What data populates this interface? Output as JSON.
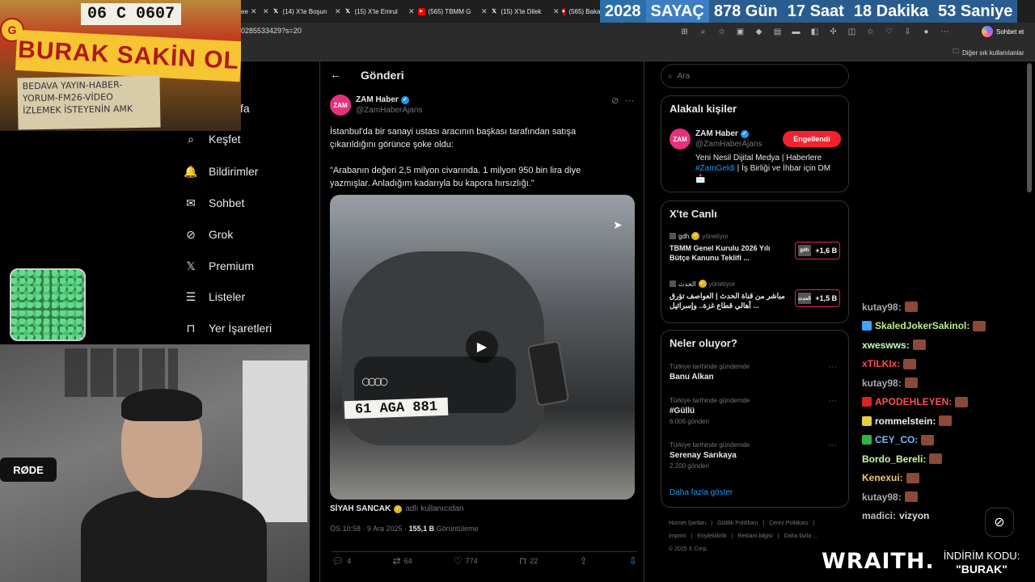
{
  "browser": {
    "tabs": [
      {
        "icon": "x",
        "label": "(14) X'te Boşun"
      },
      {
        "icon": "x",
        "label": "(15) X'te Emrul"
      },
      {
        "icon": "yt",
        "label": "(565) TBMM G"
      },
      {
        "icon": "x",
        "label": "(15) X'te Dilek"
      },
      {
        "icon": "yt",
        "label": "(565) Baka"
      }
    ],
    "partial_tab": "ee",
    "url": "0285533429?s=20",
    "copilot_label": "Sohbet et",
    "bookmarks_label": "Diğer sık kullanılanlar"
  },
  "countdown": {
    "year": "2028",
    "label": "SAYAÇ",
    "days": "878 Gün",
    "hours": "17 Saat",
    "minutes": "18 Dakika",
    "seconds": "53 Saniye"
  },
  "overlay": {
    "plate": "06 C 0607",
    "banner": "BURAK SAKİN OL",
    "cardboard": "BEDAVA YAYIN-HABER-\nYORUM-FM26-VİDEO\nİZLEMEK İSTEYENİN AMK",
    "mic_brand": "RØDE"
  },
  "nav": {
    "partial_home": "yfa",
    "items": [
      {
        "icon": "search-icon",
        "glyph": "⌕",
        "label": "Keşfet"
      },
      {
        "icon": "bell-icon",
        "glyph": "🔔",
        "label": "Bildirimler"
      },
      {
        "icon": "mail-icon",
        "glyph": "✉",
        "label": "Sohbet"
      },
      {
        "icon": "grok-icon",
        "glyph": "⊘",
        "label": "Grok"
      },
      {
        "icon": "x-logo-icon",
        "glyph": "𝕏",
        "label": "Premium"
      },
      {
        "icon": "list-icon",
        "glyph": "☰",
        "label": "Listeler"
      },
      {
        "icon": "bookmark-icon",
        "glyph": "⊓",
        "label": "Yer İşaretleri"
      }
    ]
  },
  "post": {
    "header": "Gönderi",
    "author_name": "ZAM Haber",
    "author_handle": "@ZamHaberAjans",
    "avatar_text": "ZAM",
    "text": "İstanbul'da bir sanayi ustası aracının başkası tarafından satışa\nçıkarıldığını görünce şoke oldu:\n\n\"Arabanın değeri 2,5 milyon civarında. 1 milyon 950 bin lira diye\nyazmışlar. Anladığım kadarıyla bu kapora hırsızlığı.\"",
    "video_plate": "61 AGA 881",
    "credit_name": "SİYAH SANCAK",
    "credit_sub": "adlı kullanıcıdan",
    "time": "ÖS 10:58 · 9 Ara 2025 · ",
    "views_count": "155,1 B",
    "views_label": " Görüntüleme",
    "actions": {
      "replies": "4",
      "reposts": "64",
      "likes": "774",
      "bookmarks": "22"
    }
  },
  "right": {
    "search_placeholder": "Ara",
    "related": {
      "title": "Alakalı kişiler",
      "name": "ZAM Haber",
      "handle": "@ZamHaberAjans",
      "button": "Engellendi",
      "bio_pre": "Yeni Nesil Dijital Medya | Haberlere",
      "bio_tag": "#ZamGeldi",
      "bio_post": " | İş Birliği ve İhbar için DM",
      "bio_emoji": "📩"
    },
    "live": {
      "title": "X'te Canlı",
      "items": [
        {
          "host": "gdh",
          "role": "yönetiyor",
          "title": "TBMM Genel Kurulu 2026 Yılı Bütçe Kanunu Teklifi ...",
          "mini": "gdh",
          "count": "+1,6 B"
        },
        {
          "host": "الحدث",
          "role": "yönetiyor",
          "title": "مباشر من قناة الحدث | العواصف تؤرق أهالي قطاع غزة.. وإسرائيل ...",
          "mini": "الحدث",
          "count": "+1,5 B"
        }
      ]
    },
    "trends": {
      "title": "Neler oluyor?",
      "items": [
        {
          "context": "Türkiye tarihinde gündemde",
          "name": "Banu Alkan",
          "count": ""
        },
        {
          "context": "Türkiye tarihinde gündemde",
          "name": "#Güllü",
          "count": "6.006 gönderi"
        },
        {
          "context": "Türkiye tarihinde gündemde",
          "name": "Serenay Sarıkaya",
          "count": "2.200 gönderi"
        }
      ],
      "show_more": "Daha fazla göster"
    },
    "footer": [
      "Hizmet Şartları",
      "|",
      "Gizlilik Politikası",
      "|",
      "Çerez Politikası",
      "|",
      "Imprint",
      "|",
      "Erişilebilirlik",
      "|",
      "Reklam bilgisi",
      "|",
      "Daha fazla ...",
      "© 2025 X Corp."
    ]
  },
  "chat": [
    {
      "user": "kutay98:",
      "color": "#a9a9a9",
      "badge": "",
      "msg": ""
    },
    {
      "user": "SkaledJokerSakinol:",
      "color": "#b8f08a",
      "badge": "#3aa6ff",
      "msg": ""
    },
    {
      "user": "xweswws:",
      "color": "#c0ffc0",
      "badge": "",
      "msg": ""
    },
    {
      "user": "xTILKIx:",
      "color": "#ff4c4c",
      "badge": "",
      "msg": ""
    },
    {
      "user": "kutay98:",
      "color": "#a9a9a9",
      "badge": "",
      "msg": ""
    },
    {
      "user": "APODEHLEYEN:",
      "color": "#ff5050",
      "badge": "#d22",
      "msg": ""
    },
    {
      "user": "rommelstein:",
      "color": "#f0f0f0",
      "badge": "#e6d23a",
      "msg": ""
    },
    {
      "user": "CEY_CO:",
      "color": "#7ab6ff",
      "badge": "#2fb34a",
      "msg": ""
    },
    {
      "user": "Bordo_Bereli:",
      "color": "#c8ffa0",
      "badge": "",
      "msg": ""
    },
    {
      "user": "Kenexui:",
      "color": "#f5c86a",
      "badge": "",
      "msg": ""
    },
    {
      "user": "kutay98:",
      "color": "#a9a9a9",
      "badge": "",
      "msg": ""
    },
    {
      "user": "madici:",
      "color": "#bdbdbd",
      "badge": "",
      "msg": "vizyon"
    }
  ],
  "ad": {
    "brand": "WRAITH.",
    "promo_label": "İNDİRİM KODU:",
    "promo_code": "\"BURAK\""
  }
}
